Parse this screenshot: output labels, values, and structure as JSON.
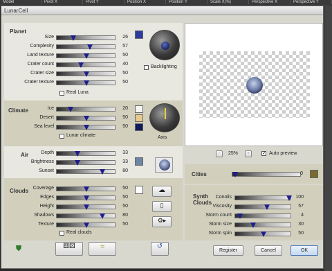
{
  "top_tabs": [
    "Model",
    "Pivot X",
    "Pivot Y",
    "Position X",
    "Position Y",
    "Scale X(%)",
    "Perspective X",
    "Perspective Y"
  ],
  "window": {
    "title": "LunarCell"
  },
  "planet": {
    "section": "Planet",
    "sliders": [
      {
        "label": "Size",
        "value": "26",
        "frac": 0.26
      },
      {
        "label": "Complexity",
        "value": "57",
        "frac": 0.57
      },
      {
        "label": "Land texture",
        "value": "50",
        "frac": 0.5
      },
      {
        "label": "Crater count",
        "value": "40",
        "frac": 0.4
      },
      {
        "label": "Crater size",
        "value": "50",
        "frac": 0.5
      },
      {
        "label": "Crater texture",
        "value": "50",
        "frac": 0.5
      }
    ],
    "real_luna": "Real Luna",
    "backlighting": "Backlighting",
    "color": "#2b3d9e"
  },
  "climate": {
    "section": "Climate",
    "sliders": [
      {
        "label": "Ice",
        "value": "20",
        "frac": 0.2,
        "color": "#f4f4f2"
      },
      {
        "label": "Desert",
        "value": "50",
        "frac": 0.5,
        "color": "#e8c98e"
      },
      {
        "label": "Sea level",
        "value": "50",
        "frac": 0.5,
        "color": "#101a5a"
      }
    ],
    "lunar_climate": "Lunar climate",
    "axis": "Axis"
  },
  "air": {
    "section": "Air",
    "sliders": [
      {
        "label": "Depth",
        "value": "33",
        "frac": 0.33
      },
      {
        "label": "Brightness",
        "value": "33",
        "frac": 0.33
      },
      {
        "label": "Sunset",
        "value": "80",
        "frac": 0.8
      }
    ],
    "color": "#6a86a4"
  },
  "clouds": {
    "section": "Clouds",
    "sliders": [
      {
        "label": "Coverage",
        "value": "50",
        "frac": 0.5
      },
      {
        "label": "Edges",
        "value": "50",
        "frac": 0.5
      },
      {
        "label": "Height",
        "value": "50",
        "frac": 0.5
      },
      {
        "label": "Shadows",
        "value": "80",
        "frac": 0.8
      },
      {
        "label": "Texture",
        "value": "50",
        "frac": 0.5
      }
    ],
    "real_clouds": "Real clouds",
    "color": "#ffffff"
  },
  "preview": {
    "zoom": "25%",
    "auto_preview": "Auto preview"
  },
  "cities": {
    "label": "Cities",
    "value": "0",
    "frac": 0.0,
    "color": "#7a6a2e"
  },
  "synth": {
    "section": "Synth Clouds",
    "sliders": [
      {
        "label": "Conolis",
        "value": "100",
        "frac": 1.0
      },
      {
        "label": "Viscosity",
        "value": "57",
        "frac": 0.57
      },
      {
        "label": "Storm count",
        "value": "4",
        "frac": 0.04
      },
      {
        "label": "Storm size",
        "value": "30",
        "frac": 0.3
      },
      {
        "label": "Storm spin",
        "value": "50",
        "frac": 0.5
      }
    ]
  },
  "buttons": {
    "register": "Register",
    "cancel": "Cancel",
    "ok": "OK",
    "zoom_minus": "-",
    "zoom_plus": "+"
  }
}
